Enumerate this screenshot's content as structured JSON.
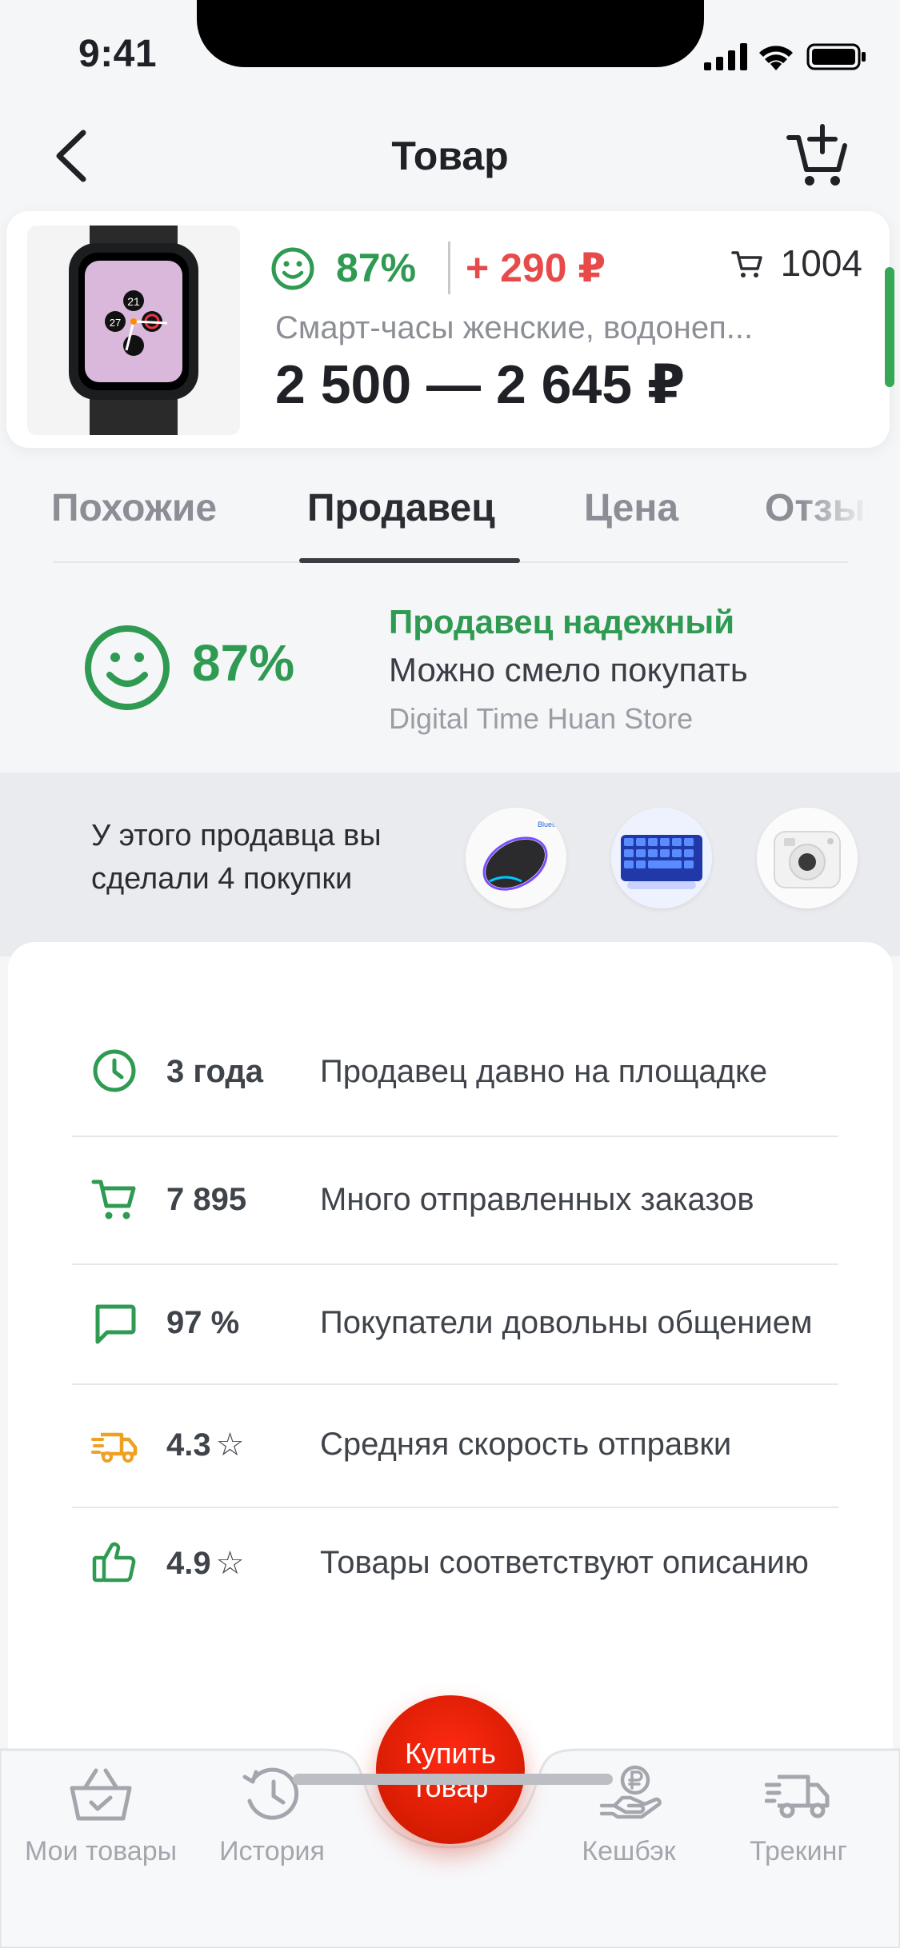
{
  "status_bar": {
    "time": "9:41"
  },
  "nav": {
    "title": "Товар"
  },
  "product": {
    "rating": "87%",
    "cashback": "+ 290 ₽",
    "cart_count": "1004",
    "title": "Смарт-часы женские, водонеп...",
    "price": "2 500 — 2 645 ₽",
    "watch_face_number": "21",
    "watch_face_small": "27"
  },
  "tabs": [
    "Похожие",
    "Продавец",
    "Цена",
    "Отзывы"
  ],
  "active_tab": "Продавец",
  "seller": {
    "rating": "87%",
    "status": "Продавец надежный",
    "subtitle": "Можно смело покупать",
    "store_name": "Digital Time Huan Store"
  },
  "purchases": {
    "text": "У этого продавца вы сделали 4 покупки",
    "thumbs": [
      "mouse-thumb",
      "keyboard-thumb",
      "camera-thumb"
    ]
  },
  "stats": [
    {
      "icon": "clock-icon",
      "value": "3 года",
      "label": "Продавец давно на площадке"
    },
    {
      "icon": "cart-icon",
      "value": "7 895",
      "label": "Много отправленных заказов"
    },
    {
      "icon": "chat-icon",
      "value": "97 %",
      "label": "Покупатели довольны общением"
    },
    {
      "icon": "truck-icon",
      "value": "4.3",
      "star": "☆",
      "label": "Средняя скорость отправки"
    },
    {
      "icon": "thumbs-up-icon",
      "value": "4.9",
      "star": "☆",
      "label": "Товары соответствуют описанию"
    }
  ],
  "tab_bar": {
    "my_items": "Мои товары",
    "history": "История",
    "buy_line1": "Купить",
    "buy_line2": "товар",
    "cashback": "Кешбэк",
    "tracking": "Трекинг"
  },
  "colors": {
    "green": "#2f9a52",
    "red": "#e84a4a",
    "orange": "#f0a020",
    "buy_button": "#e01e00"
  }
}
